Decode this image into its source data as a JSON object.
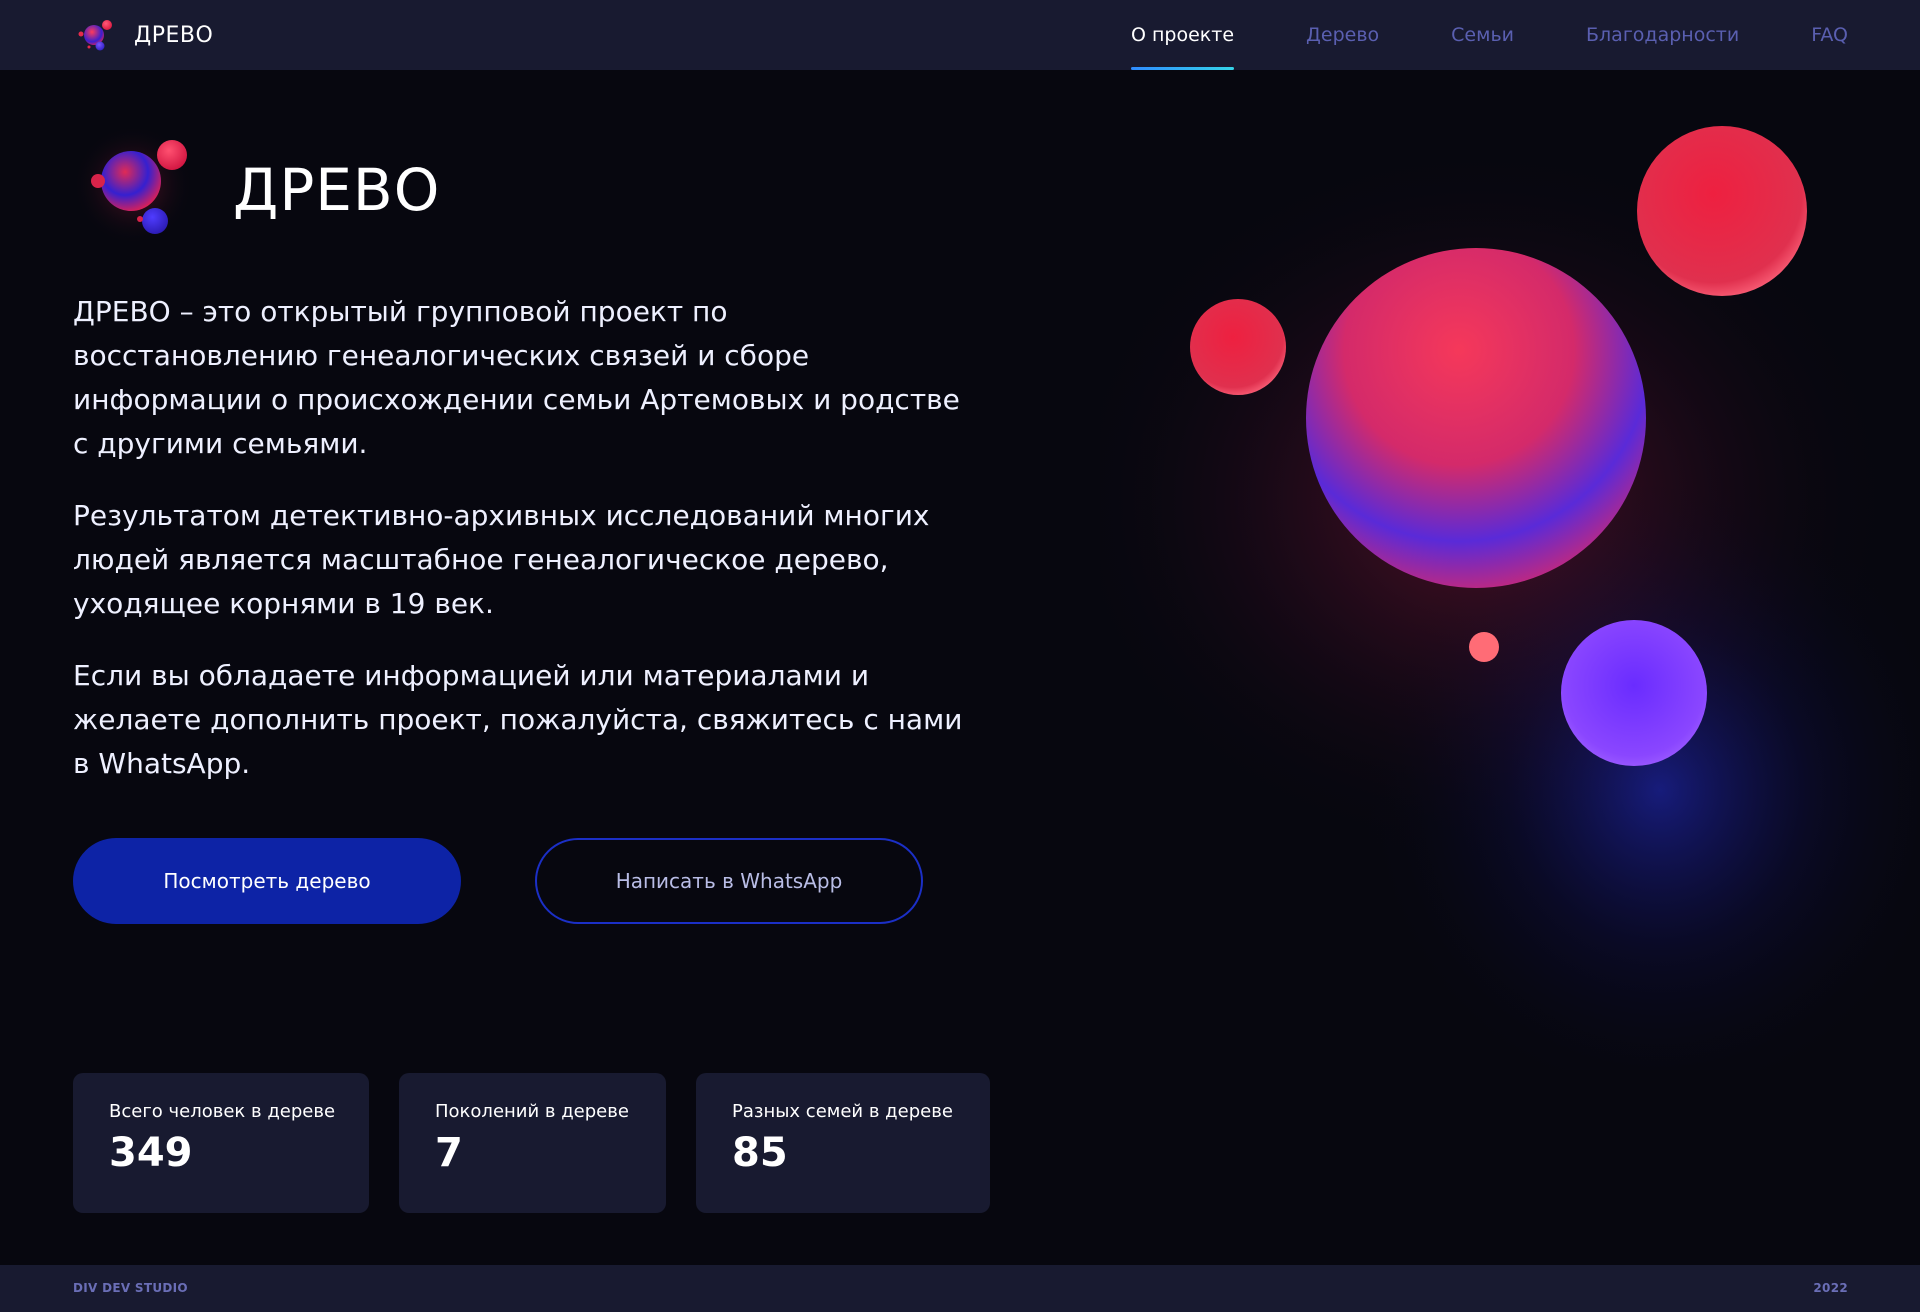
{
  "nav": {
    "brand": "ДРЕВО",
    "items": [
      {
        "label": "О проекте",
        "active": true
      },
      {
        "label": "Дерево",
        "active": false
      },
      {
        "label": "Семьи",
        "active": false
      },
      {
        "label": "Благодарности",
        "active": false
      },
      {
        "label": "FAQ",
        "active": false
      }
    ]
  },
  "hero": {
    "title": "ДРЕВО",
    "paragraphs": [
      "ДРЕВО – это открытый групповой проект по восстановлению генеалогических связей и сборе информации о происхождении семьи Артемовых и родстве с другими семьями.",
      "Результатом детективно-архивных исследований многих людей является масштабное генеалогическое дерево, уходящее корнями в 19 век.",
      "Если вы обладаете информацией или материалами и желаете дополнить проект, пожалуйста, свяжитесь с нами в WhatsApp."
    ],
    "primary_button": "Посмотреть дерево",
    "secondary_button": "Написать в WhatsApp"
  },
  "stats": [
    {
      "label": "Всего человек в дереве",
      "value": "349"
    },
    {
      "label": "Поколений в дереве",
      "value": "7"
    },
    {
      "label": "Разных семей в дереве",
      "value": "85"
    }
  ],
  "footer": {
    "left": "DIV DEV STUDIO",
    "right": "2022"
  },
  "colors": {
    "background": "#07070f",
    "panel": "#181a30",
    "accent_blue": "#0d23a6",
    "nav_inactive": "#5a5fb0",
    "nav_underline": "#35d4e8"
  },
  "icons": {
    "logo": "bubbles-logo-icon"
  }
}
